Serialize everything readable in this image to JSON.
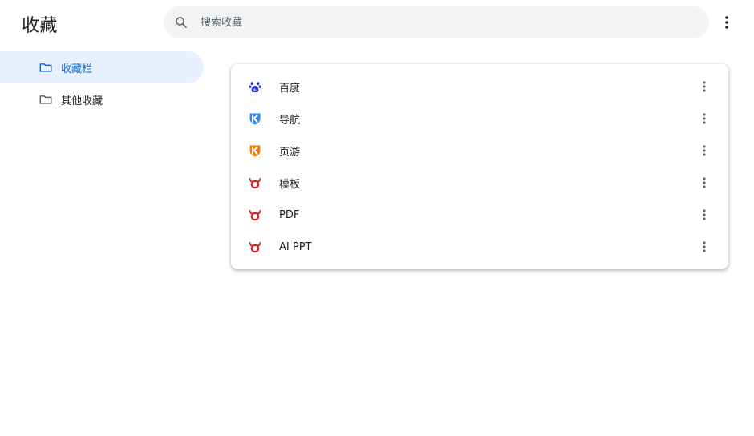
{
  "header": {
    "title": "收藏",
    "search_placeholder": "搜索收藏",
    "search_value": ""
  },
  "sidebar": {
    "items": [
      {
        "label": "收藏栏",
        "icon": "folder-icon",
        "active": true
      },
      {
        "label": "其他收藏",
        "icon": "folder-icon",
        "active": false
      }
    ]
  },
  "bookmarks": [
    {
      "title": "百度",
      "icon": "baidu-paw-icon"
    },
    {
      "title": "导航",
      "icon": "blue-shield-k-icon"
    },
    {
      "title": "页游",
      "icon": "orange-shield-k-icon"
    },
    {
      "title": "模板",
      "icon": "red-bull-icon"
    },
    {
      "title": "PDF",
      "icon": "red-bull-icon"
    },
    {
      "title": "AI PPT",
      "icon": "red-bull-icon"
    }
  ],
  "colors": {
    "accent": "#1967d2",
    "active_bg": "#e8f0fe",
    "search_bg": "#f1f3f4",
    "baidu_blue": "#2932e1",
    "shield_blue": "#2d8cf0",
    "shield_orange": "#f57c00",
    "bull_red": "#e02020"
  }
}
